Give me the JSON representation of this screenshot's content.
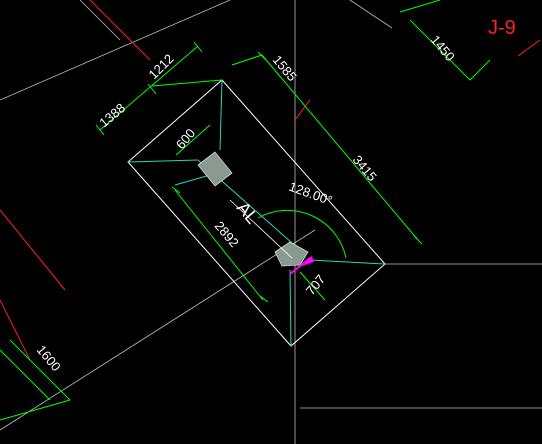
{
  "drawing": {
    "grid_label": "J-9",
    "dimensions": [
      "1212",
      "1388",
      "1585",
      "600",
      "3415",
      "2892",
      "707",
      "1450",
      "1600"
    ],
    "angle_label": "128.00°",
    "beam_label": "AL"
  },
  "colors": {
    "background": "#000000",
    "dimension_green": "#00ff00",
    "outline_white": "#ffffff",
    "axis_red": "#ff2020",
    "column_fill": "#8a9a90",
    "marker_magenta": "#ff00ff",
    "hatch_cyan": "#2ad6b8"
  }
}
